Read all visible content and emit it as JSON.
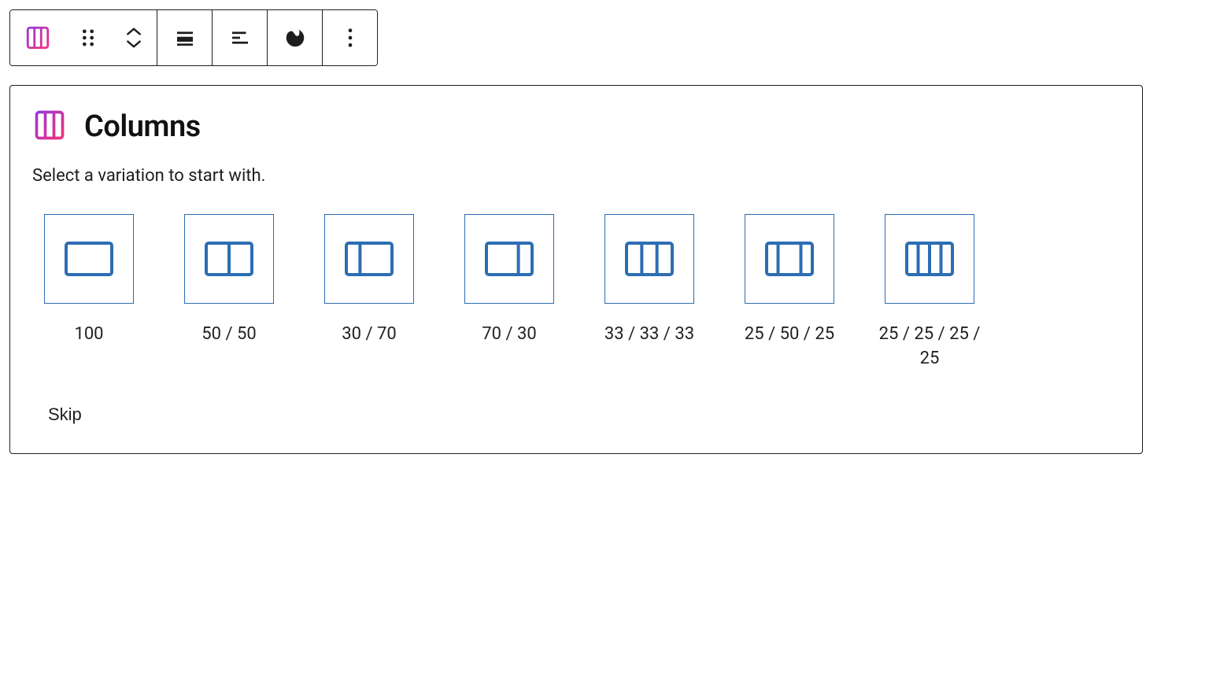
{
  "panel": {
    "title": "Columns",
    "description": "Select a variation to start with.",
    "skip_label": "Skip"
  },
  "toolbar": {
    "items": [
      "columns-block",
      "drag",
      "move",
      "align",
      "justify",
      "style",
      "more"
    ]
  },
  "variations": [
    {
      "label": "100",
      "cols": [
        100
      ]
    },
    {
      "label": "50 / 50",
      "cols": [
        50,
        50
      ]
    },
    {
      "label": "30 / 70",
      "cols": [
        30,
        70
      ]
    },
    {
      "label": "70 / 30",
      "cols": [
        70,
        30
      ]
    },
    {
      "label": "33 / 33 / 33",
      "cols": [
        33,
        33,
        33
      ]
    },
    {
      "label": "25 / 50 / 25",
      "cols": [
        25,
        50,
        25
      ]
    },
    {
      "label": "25 / 25 / 25 / 25",
      "cols": [
        25,
        25,
        25,
        25
      ]
    }
  ],
  "colors": {
    "icon_blue": "#2c6db3",
    "grad_start": "#8b3ae6",
    "grad_end": "#ff2e6e"
  }
}
